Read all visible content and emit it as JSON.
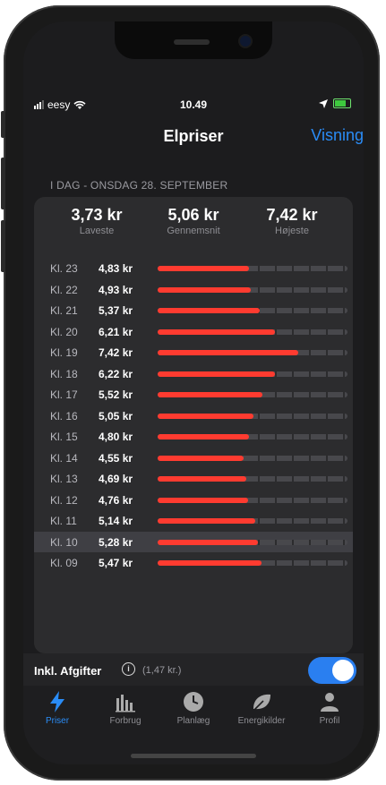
{
  "status_bar": {
    "carrier": "eesy",
    "time": "10.49"
  },
  "nav": {
    "title": "Elpriser",
    "action_label": "Visning"
  },
  "section_header": "I DAG - ONSDAG 28. SEPTEMBER",
  "summary": [
    {
      "value": "3,73 kr",
      "label": "Laveste"
    },
    {
      "value": "5,06 kr",
      "label": "Gennemsnit"
    },
    {
      "value": "7,42 kr",
      "label": "Højeste"
    }
  ],
  "price_rows": [
    {
      "hour": "Kl. 23",
      "price": "4,83 kr",
      "value": 4.83
    },
    {
      "hour": "Kl. 22",
      "price": "4,93 kr",
      "value": 4.93
    },
    {
      "hour": "Kl. 21",
      "price": "5,37 kr",
      "value": 5.37
    },
    {
      "hour": "Kl. 20",
      "price": "6,21 kr",
      "value": 6.21
    },
    {
      "hour": "Kl. 19",
      "price": "7,42 kr",
      "value": 7.42
    },
    {
      "hour": "Kl. 18",
      "price": "6,22 kr",
      "value": 6.22
    },
    {
      "hour": "Kl. 17",
      "price": "5,52 kr",
      "value": 5.52
    },
    {
      "hour": "Kl. 16",
      "price": "5,05 kr",
      "value": 5.05
    },
    {
      "hour": "Kl. 15",
      "price": "4,80 kr",
      "value": 4.8
    },
    {
      "hour": "Kl. 14",
      "price": "4,55 kr",
      "value": 4.55
    },
    {
      "hour": "Kl. 13",
      "price": "4,69 kr",
      "value": 4.69
    },
    {
      "hour": "Kl. 12",
      "price": "4,76 kr",
      "value": 4.76
    },
    {
      "hour": "Kl. 11",
      "price": "5,14 kr",
      "value": 5.14
    },
    {
      "hour": "Kl. 10",
      "price": "5,28 kr",
      "value": 5.28,
      "selected": true
    },
    {
      "hour": "Kl. 09",
      "price": "5,47 kr",
      "value": 5.47
    }
  ],
  "fees": {
    "label": "Inkl. Afgifter",
    "amount": "(1,47 kr.)",
    "enabled": true
  },
  "tabs": [
    {
      "label": "Priser",
      "icon": "bolt-icon",
      "active": true
    },
    {
      "label": "Forbrug",
      "icon": "bar-chart-icon"
    },
    {
      "label": "Planlæg",
      "icon": "clock-icon"
    },
    {
      "label": "Energikilder",
      "icon": "leaf-icon"
    },
    {
      "label": "Profil",
      "icon": "person-icon"
    }
  ],
  "colors": {
    "accent": "#2a8cf6",
    "bar": "#ff3b30",
    "toggle_on": "#2a7ff0",
    "background": "#1c1c1e"
  }
}
